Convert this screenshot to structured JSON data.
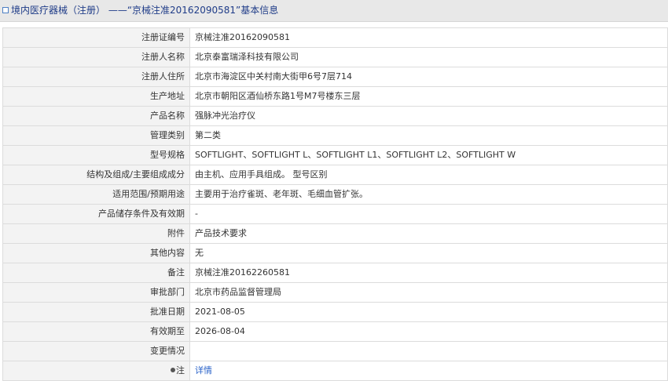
{
  "header": {
    "title": "境内医疗器械（注册） ——“京械注准20162090581”基本信息"
  },
  "rows": [
    {
      "label": "注册证编号",
      "value": "京械注准20162090581"
    },
    {
      "label": "注册人名称",
      "value": "北京泰富瑞泽科技有限公司"
    },
    {
      "label": "注册人住所",
      "value": "北京市海淀区中关村南大街甲6号7层714"
    },
    {
      "label": "生产地址",
      "value": "北京市朝阳区酒仙桥东路1号M7号楼东三层"
    },
    {
      "label": "产品名称",
      "value": "强脉冲光治疗仪"
    },
    {
      "label": "管理类别",
      "value": "第二类"
    },
    {
      "label": "型号规格",
      "value": "SOFTLIGHT、SOFTLIGHT L、SOFTLIGHT L1、SOFTLIGHT L2、SOFTLIGHT W"
    },
    {
      "label": "结构及组成/主要组成成分",
      "value": "由主机、应用手具组成。 型号区别"
    },
    {
      "label": "适用范围/预期用途",
      "value": "主要用于治疗雀斑、老年斑、毛细血管扩张。"
    },
    {
      "label": "产品储存条件及有效期",
      "value": "-"
    },
    {
      "label": "附件",
      "value": "产品技术要求"
    },
    {
      "label": "其他内容",
      "value": "无"
    },
    {
      "label": "备注",
      "value": "京械注准20162260581"
    },
    {
      "label": "审批部门",
      "value": "北京市药品监督管理局"
    },
    {
      "label": "批准日期",
      "value": "2021-08-05"
    },
    {
      "label": "有效期至",
      "value": "2026-08-04"
    },
    {
      "label": "变更情况",
      "value": ""
    }
  ],
  "note_row": {
    "label": "注",
    "link": "详情",
    "icon": "pin-icon"
  }
}
